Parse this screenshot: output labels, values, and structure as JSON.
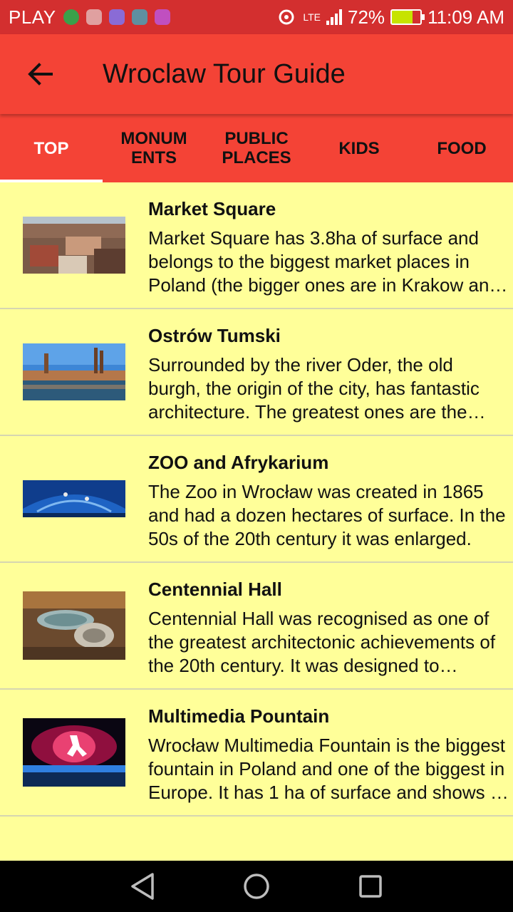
{
  "status_bar": {
    "carrier": "PLAY",
    "network_label": "LTE",
    "battery_percent": "72%",
    "battery_level": 0.72,
    "time": "11:09 AM"
  },
  "app_bar": {
    "title": "Wroclaw Tour Guide",
    "back_icon": "arrow-back-icon"
  },
  "tabs": [
    {
      "label": "TOP",
      "active": true
    },
    {
      "label": "MONUM ENTS",
      "active": false
    },
    {
      "label": "PUBLIC PLACES",
      "active": false
    },
    {
      "label": "KIDS",
      "active": false
    },
    {
      "label": "FOOD",
      "active": false
    }
  ],
  "items": [
    {
      "title": "Market Square",
      "description": "Market Square has 3.8ha of surface and belongs to the biggest market places in Poland (the bigger ones are in Krakow and Gdansk)."
    },
    {
      "title": "Ostrów Tumski",
      "description": "Surrounded by the river Oder, the old burgh, the origin of the city, has fantastic architecture. The greatest ones are the Cathedral and churches."
    },
    {
      "title": "ZOO and Afrykarium",
      "description": "The Zoo in Wrocław was created in 1865 and had a dozen hectares of surface. In the 50s of the 20th century it was enlarged."
    },
    {
      "title": "Centennial Hall",
      "description": "Centennial Hall was recognised as one of the greatest architectonic achievements of the 20th century. It was designed to celebrate the anniversary."
    },
    {
      "title": "Multimedia Pountain",
      "description": "Wrocław Multimedia Fountain is the biggest fountain in Poland and one of the biggest in Europe. It has 1 ha of surface and shows at night."
    }
  ],
  "colors": {
    "status_bar": "#d32f2f",
    "app_bar": "#f44336",
    "list_background": "#ffff99",
    "nav_bar": "#000000"
  }
}
